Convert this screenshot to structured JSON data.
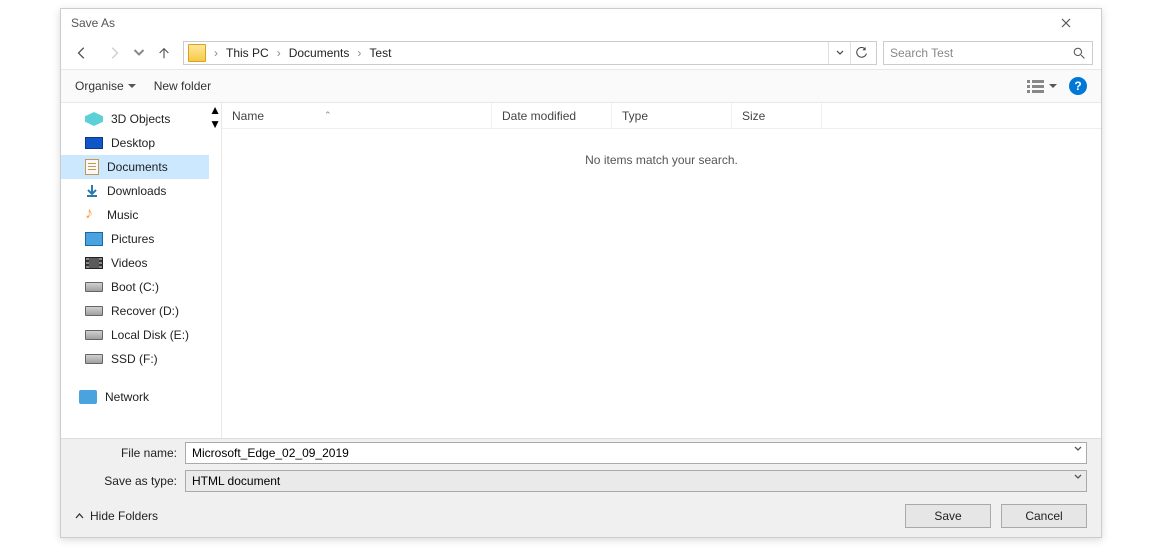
{
  "title": "Save As",
  "breadcrumbs": {
    "b0": "This PC",
    "b1": "Documents",
    "b2": "Test"
  },
  "search": {
    "placeholder": "Search Test"
  },
  "toolbar": {
    "organise": "Organise",
    "newfolder": "New folder",
    "help": "?"
  },
  "sidebar": {
    "items": {
      "i0": "3D Objects",
      "i1": "Desktop",
      "i2": "Documents",
      "i3": "Downloads",
      "i4": "Music",
      "i5": "Pictures",
      "i6": "Videos",
      "i7": "Boot (C:)",
      "i8": "Recover (D:)",
      "i9": "Local Disk (E:)",
      "i10": "SSD (F:)",
      "i11": "Network"
    }
  },
  "columns": {
    "name": "Name",
    "date": "Date modified",
    "type": "Type",
    "size": "Size"
  },
  "list": {
    "empty": "No items match your search."
  },
  "fields": {
    "filename_label": "File name:",
    "filename_value": "Microsoft_Edge_02_09_2019",
    "savetype_label": "Save as type:",
    "savetype_value": "HTML document"
  },
  "footer": {
    "hide": "Hide Folders",
    "save": "Save",
    "cancel": "Cancel"
  }
}
